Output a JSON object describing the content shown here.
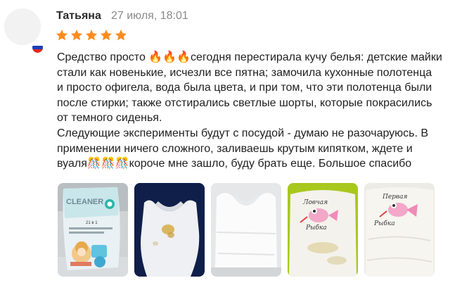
{
  "review": {
    "author": "Татьяна",
    "date": "27 июля, 18:01",
    "rating": 5,
    "text_lines": [
      "Средство просто 🔥🔥🔥сегодня перестирала кучу белья: детские майки",
      "стали как новенькие, исчезли все пятна; замочила кухонные полотенца",
      "и просто офигела, вода была цвета, и при том, что эти полотенца были",
      "после стирки; также отстирались светлые шорты, которые покрасились",
      "от темного сиденья.",
      "Следующие эксперименты будут с посудой - думаю не разочаруюсь. В",
      "применении ничего сложного, заливаешь крутым кипятком, ждете и",
      "вуаля🎊🎊🎊короче мне зашло, буду брать еще. Большое спасибо"
    ]
  },
  "photos": [
    {
      "name": "photo-cleaner-package",
      "package_label": "CLEANER",
      "package_sub": "21 в 1"
    },
    {
      "name": "photo-stained-tank-top"
    },
    {
      "name": "photo-clean-tank-top"
    },
    {
      "name": "photo-print-stained",
      "print_text": [
        "Ловчая",
        "Рыбка"
      ]
    },
    {
      "name": "photo-print-clean",
      "print_text": [
        "Первая",
        "Рыбка"
      ]
    }
  ],
  "colors": {
    "star": "#fc8c1f",
    "date": "#8a8a8a",
    "flag": [
      "#ffffff",
      "#1c3fb8",
      "#e0281f"
    ]
  }
}
